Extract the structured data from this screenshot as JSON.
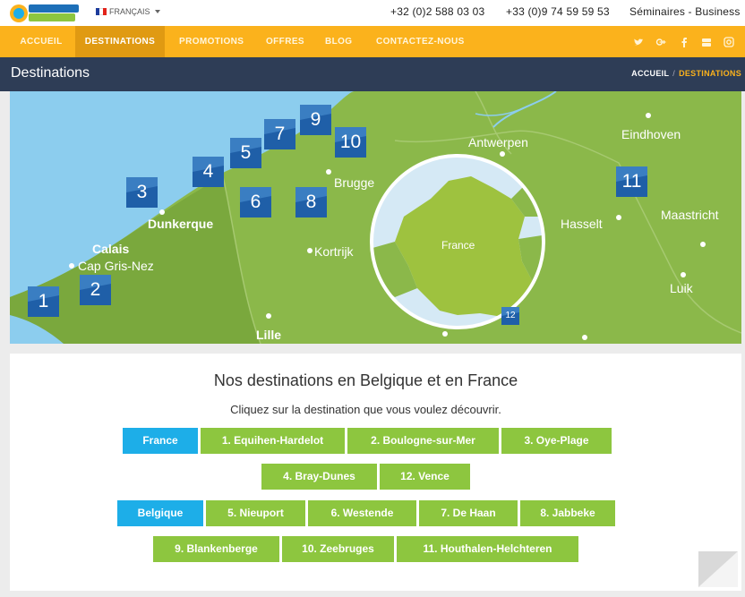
{
  "header": {
    "language": "FRANÇAIS",
    "phone_be": "+32 (0)2 588 03 03",
    "phone_fr": "+33 (0)9 74 59 59 53",
    "business_link": "Séminaires - Business",
    "flag_colors": [
      "#1d3c9c",
      "#ffffff",
      "#e2231a"
    ]
  },
  "nav": {
    "items": [
      "ACCUEIL",
      "DESTINATIONS",
      "PROMOTIONS",
      "OFFRES",
      "BLOG",
      "CONTACTEZ-NOUS"
    ],
    "active": "DESTINATIONS",
    "social_icons": [
      "twitter-icon",
      "google-plus-icon",
      "facebook-icon",
      "youtube-icon",
      "instagram-icon"
    ]
  },
  "page": {
    "title": "Destinations",
    "breadcrumb": [
      "ACCUEIL",
      "DESTINATIONS"
    ]
  },
  "map": {
    "cities": [
      "Calais",
      "Cap Gris-Nez",
      "Dunkerque",
      "Kortrijk",
      "Lille",
      "Brugge",
      "Antwerpen",
      "Eindhoven",
      "Hasselt",
      "Maastricht",
      "Luik"
    ],
    "inset_label": "France",
    "markers": [
      "1",
      "2",
      "3",
      "4",
      "5",
      "6",
      "7",
      "8",
      "9",
      "10",
      "11",
      "12"
    ]
  },
  "destinations": {
    "heading": "Nos destinations en Belgique et en France",
    "instruction": "Cliquez sur la destination que vous voulez découvrir.",
    "france_label": "France",
    "france": [
      "1. Equihen-Hardelot",
      "2. Boulogne-sur-Mer",
      "3. Oye-Plage",
      "4. Bray-Dunes",
      "12. Vence"
    ],
    "belgium_label": "Belgique",
    "belgium": [
      "5. Nieuport",
      "6. Westende",
      "7. De Haan",
      "8. Jabbeke",
      "9. Blankenberge",
      "10. Zeebruges",
      "11. Houthalen-Helchteren"
    ]
  },
  "colors": {
    "accent": "#fbb21c",
    "title_band": "#2e3d56",
    "country_button": "#1daee8",
    "destination_button": "#8dc63f",
    "marker": "#3a7ec2"
  }
}
